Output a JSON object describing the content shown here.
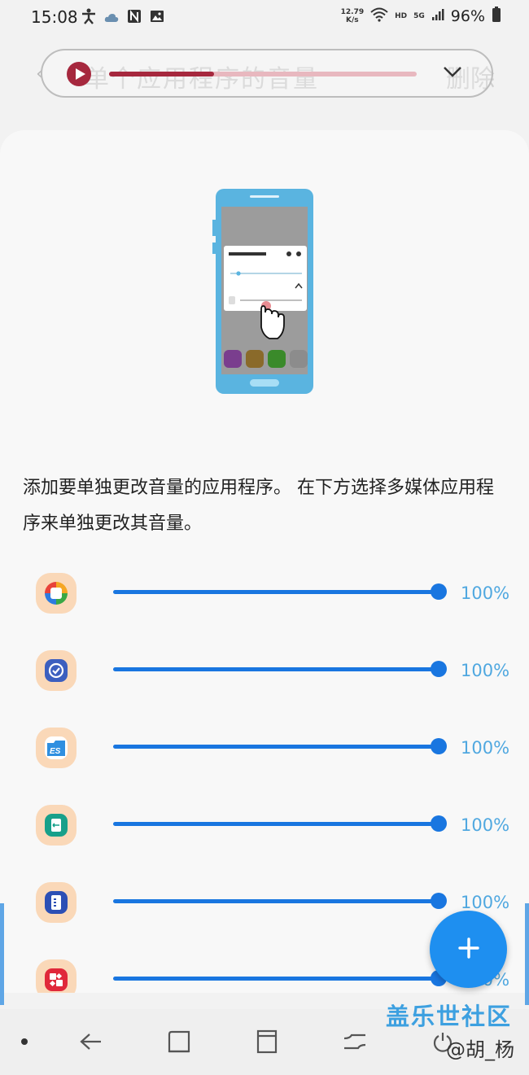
{
  "status_bar": {
    "time": "15:08",
    "net_speed_value": "12.79",
    "net_speed_unit": "K/s",
    "hd_label": "HD",
    "signal_label": "5G",
    "battery": "96%"
  },
  "header": {
    "title": "单个应用程序的音量",
    "delete_label": "删除"
  },
  "media_player": {
    "progress": 0.34,
    "accent_color": "#a6283e"
  },
  "description": "添加要单独更改音量的应用程序。 在下方选择多媒体应用程序来单独更改其音量。",
  "apps": [
    {
      "icon": "gallery-app-icon",
      "volume_label": "100%",
      "volume": 1.0
    },
    {
      "icon": "check-app-icon",
      "volume_label": "100%",
      "volume": 1.0
    },
    {
      "icon": "es-file-explorer-icon",
      "volume_label": "100%",
      "volume": 1.0
    },
    {
      "icon": "sidesync-app-icon",
      "volume_label": "100%",
      "volume": 1.0
    },
    {
      "icon": "phone-manager-icon",
      "volume_label": "100%",
      "volume": 1.0
    },
    {
      "icon": "red-puzzle-app-icon",
      "volume_label": "100%",
      "volume": 1.0
    }
  ],
  "fab": {
    "icon": "plus-icon"
  },
  "watermark": {
    "line1": "盖乐世社区",
    "line2": "@胡_杨"
  },
  "colors": {
    "slider": "#1976e0",
    "percent_text": "#50a8e0",
    "fab": "#1e8ff0"
  }
}
